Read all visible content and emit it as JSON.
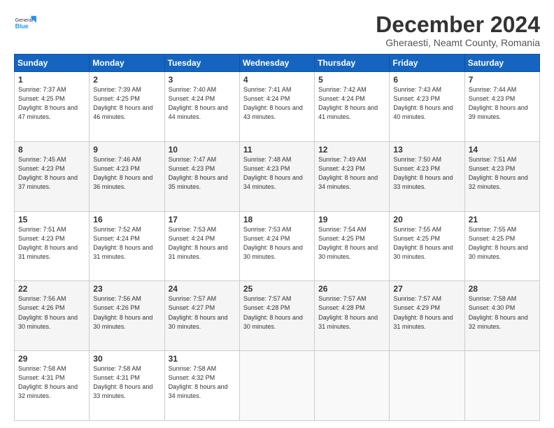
{
  "header": {
    "logo": {
      "general": "General",
      "blue": "Blue"
    },
    "title": "December 2024",
    "location": "Gheraesti, Neamt County, Romania"
  },
  "days_of_week": [
    "Sunday",
    "Monday",
    "Tuesday",
    "Wednesday",
    "Thursday",
    "Friday",
    "Saturday"
  ],
  "weeks": [
    [
      {
        "day": "1",
        "sunrise": "7:37 AM",
        "sunset": "4:25 PM",
        "daylight": "8 hours and 47 minutes."
      },
      {
        "day": "2",
        "sunrise": "7:39 AM",
        "sunset": "4:25 PM",
        "daylight": "8 hours and 46 minutes."
      },
      {
        "day": "3",
        "sunrise": "7:40 AM",
        "sunset": "4:24 PM",
        "daylight": "8 hours and 44 minutes."
      },
      {
        "day": "4",
        "sunrise": "7:41 AM",
        "sunset": "4:24 PM",
        "daylight": "8 hours and 43 minutes."
      },
      {
        "day": "5",
        "sunrise": "7:42 AM",
        "sunset": "4:24 PM",
        "daylight": "8 hours and 41 minutes."
      },
      {
        "day": "6",
        "sunrise": "7:43 AM",
        "sunset": "4:23 PM",
        "daylight": "8 hours and 40 minutes."
      },
      {
        "day": "7",
        "sunrise": "7:44 AM",
        "sunset": "4:23 PM",
        "daylight": "8 hours and 39 minutes."
      }
    ],
    [
      {
        "day": "8",
        "sunrise": "7:45 AM",
        "sunset": "4:23 PM",
        "daylight": "8 hours and 37 minutes."
      },
      {
        "day": "9",
        "sunrise": "7:46 AM",
        "sunset": "4:23 PM",
        "daylight": "8 hours and 36 minutes."
      },
      {
        "day": "10",
        "sunrise": "7:47 AM",
        "sunset": "4:23 PM",
        "daylight": "8 hours and 35 minutes."
      },
      {
        "day": "11",
        "sunrise": "7:48 AM",
        "sunset": "4:23 PM",
        "daylight": "8 hours and 34 minutes."
      },
      {
        "day": "12",
        "sunrise": "7:49 AM",
        "sunset": "4:23 PM",
        "daylight": "8 hours and 34 minutes."
      },
      {
        "day": "13",
        "sunrise": "7:50 AM",
        "sunset": "4:23 PM",
        "daylight": "8 hours and 33 minutes."
      },
      {
        "day": "14",
        "sunrise": "7:51 AM",
        "sunset": "4:23 PM",
        "daylight": "8 hours and 32 minutes."
      }
    ],
    [
      {
        "day": "15",
        "sunrise": "7:51 AM",
        "sunset": "4:23 PM",
        "daylight": "8 hours and 31 minutes."
      },
      {
        "day": "16",
        "sunrise": "7:52 AM",
        "sunset": "4:24 PM",
        "daylight": "8 hours and 31 minutes."
      },
      {
        "day": "17",
        "sunrise": "7:53 AM",
        "sunset": "4:24 PM",
        "daylight": "8 hours and 31 minutes."
      },
      {
        "day": "18",
        "sunrise": "7:53 AM",
        "sunset": "4:24 PM",
        "daylight": "8 hours and 30 minutes."
      },
      {
        "day": "19",
        "sunrise": "7:54 AM",
        "sunset": "4:25 PM",
        "daylight": "8 hours and 30 minutes."
      },
      {
        "day": "20",
        "sunrise": "7:55 AM",
        "sunset": "4:25 PM",
        "daylight": "8 hours and 30 minutes."
      },
      {
        "day": "21",
        "sunrise": "7:55 AM",
        "sunset": "4:25 PM",
        "daylight": "8 hours and 30 minutes."
      }
    ],
    [
      {
        "day": "22",
        "sunrise": "7:56 AM",
        "sunset": "4:26 PM",
        "daylight": "8 hours and 30 minutes."
      },
      {
        "day": "23",
        "sunrise": "7:56 AM",
        "sunset": "4:26 PM",
        "daylight": "8 hours and 30 minutes."
      },
      {
        "day": "24",
        "sunrise": "7:57 AM",
        "sunset": "4:27 PM",
        "daylight": "8 hours and 30 minutes."
      },
      {
        "day": "25",
        "sunrise": "7:57 AM",
        "sunset": "4:28 PM",
        "daylight": "8 hours and 30 minutes."
      },
      {
        "day": "26",
        "sunrise": "7:57 AM",
        "sunset": "4:28 PM",
        "daylight": "8 hours and 31 minutes."
      },
      {
        "day": "27",
        "sunrise": "7:57 AM",
        "sunset": "4:29 PM",
        "daylight": "8 hours and 31 minutes."
      },
      {
        "day": "28",
        "sunrise": "7:58 AM",
        "sunset": "4:30 PM",
        "daylight": "8 hours and 32 minutes."
      }
    ],
    [
      {
        "day": "29",
        "sunrise": "7:58 AM",
        "sunset": "4:31 PM",
        "daylight": "8 hours and 32 minutes."
      },
      {
        "day": "30",
        "sunrise": "7:58 AM",
        "sunset": "4:31 PM",
        "daylight": "8 hours and 33 minutes."
      },
      {
        "day": "31",
        "sunrise": "7:58 AM",
        "sunset": "4:32 PM",
        "daylight": "8 hours and 34 minutes."
      },
      null,
      null,
      null,
      null
    ]
  ],
  "labels": {
    "sunrise_prefix": "Sunrise: ",
    "sunset_prefix": "Sunset: ",
    "daylight_prefix": "Daylight: "
  }
}
